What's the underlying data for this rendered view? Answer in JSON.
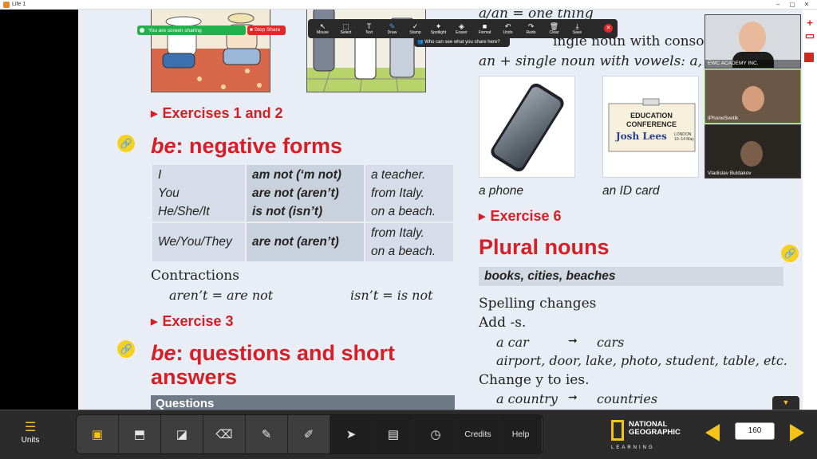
{
  "window": {
    "title": "Life 1"
  },
  "book": {
    "exercises_1_2": "Exercises 1 and 2",
    "neg_heading_em": "be",
    "neg_heading_rest": ": negative forms",
    "table": [
      {
        "subject": "I",
        "verb": "am not (‘m not)",
        "complement": "a teacher."
      },
      {
        "subject": "You",
        "verb": "are not (aren’t)",
        "complement": "from Italy."
      },
      {
        "subject": "He/She/It",
        "verb": "is not (isn’t)",
        "complement": "on a beach."
      },
      {
        "subject": "We/You/They",
        "verb": "are not (aren’t)",
        "complement": "from Italy.",
        "complement2": "on a beach."
      }
    ],
    "contractions_label": "Contractions",
    "contraction_1a": "aren’t",
    "contraction_1b": "= are not",
    "contraction_2a": "isn’t",
    "contraction_2b": "= is not",
    "exercise_3": "Exercise 3",
    "qa_heading_em": "be",
    "qa_heading_rest": ": questions and short",
    "qa_heading_line2": "answers",
    "questions_bar": "Questions",
    "rule_1": "a/an = one thing",
    "rule_2": "ingle noun with consonants:",
    "rule_3_prefix": "an + single noun with vowels:",
    "rule_3_suffix": "a, e",
    "caption_phone": "a phone",
    "caption_id": "an ID card",
    "id_card": {
      "line1": "EDUCATION",
      "line2": "CONFERENCE",
      "name": "Josh Lees",
      "place": "LONDON",
      "dates": "10–14 May"
    },
    "exercise_6": "Exercise 6",
    "plural_heading": "Plural nouns",
    "plural_examples": "books, cities, beaches",
    "spelling_changes": "Spelling changes",
    "add_s": "Add -s.",
    "ex_a_car": "a car",
    "arrow": "➞",
    "ex_cars": "cars",
    "ex_list": "airport, door, lake, photo, student, table, etc.",
    "change_y": "Change y to ies.",
    "ex_country": "a country",
    "ex_countries": "countries"
  },
  "zoom": {
    "share_status": "You are screen sharing",
    "stop_share": "Stop Share",
    "tools": [
      {
        "label": "Mouse",
        "icon": "cursor-icon",
        "glyph": "↖"
      },
      {
        "label": "Select",
        "icon": "select-icon",
        "glyph": "⬚"
      },
      {
        "label": "Text",
        "icon": "text-icon",
        "glyph": "T"
      },
      {
        "label": "Draw",
        "icon": "draw-icon",
        "glyph": "✎"
      },
      {
        "label": "Stamp",
        "icon": "stamp-icon",
        "glyph": "✓"
      },
      {
        "label": "Spotlight",
        "icon": "spotlight-icon",
        "glyph": "✦"
      },
      {
        "label": "Eraser",
        "icon": "eraser-icon",
        "glyph": "◈"
      },
      {
        "label": "Format",
        "icon": "format-icon",
        "glyph": "■"
      },
      {
        "label": "Undo",
        "icon": "undo-icon",
        "glyph": "↶"
      },
      {
        "label": "Redo",
        "icon": "redo-icon",
        "glyph": "↷"
      },
      {
        "label": "Clear",
        "icon": "clear-icon",
        "glyph": "🗑"
      },
      {
        "label": "Save",
        "icon": "save-icon",
        "glyph": "⤓"
      }
    ],
    "who_can_see": "Who can see what you share here?",
    "participants": [
      {
        "name": "EWC ACADEMY INC."
      },
      {
        "name": "IPhoneSvetik"
      },
      {
        "name": "Vladislav Buldakov"
      }
    ]
  },
  "bottombar": {
    "units_label": "Units",
    "credits": "Credits",
    "help": "Help",
    "brand_line1": "NATIONAL",
    "brand_line2": "GEOGRAPHIC",
    "brand_sub": "LEARNING",
    "page_number": "160"
  },
  "colors": {
    "accent_red": "#d41f26",
    "accent_yellow": "#f6c318",
    "zoom_green": "#22b14c"
  }
}
